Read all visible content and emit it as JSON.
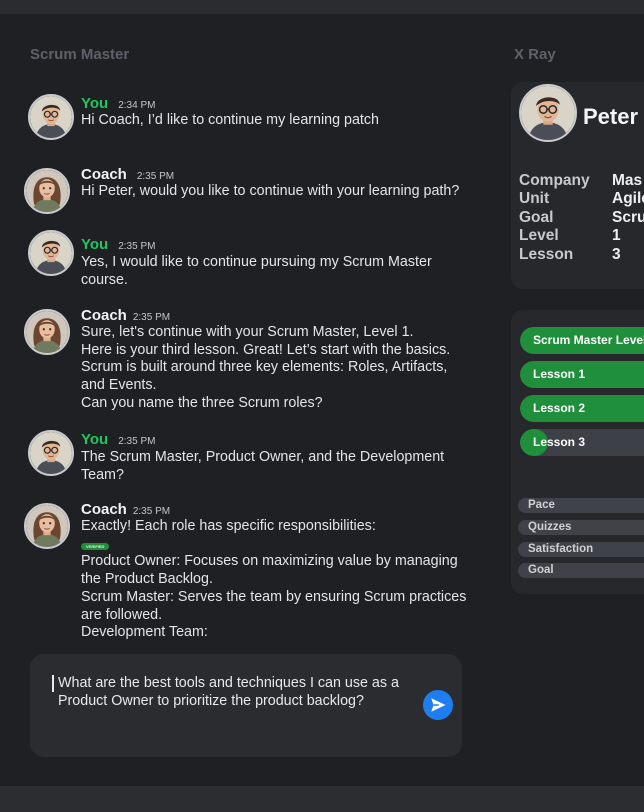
{
  "left_panel": {
    "title": "Scrum Master"
  },
  "right_panel": {
    "title": "X Ray"
  },
  "messages": [
    {
      "sender": "You",
      "time": "2:34 PM",
      "text": "Hi Coach, I’d like to continue my learning patch"
    },
    {
      "sender": "Coach",
      "time": "2:35 PM",
      "text": "Hi Peter, would you like to continue with your learning path?"
    },
    {
      "sender": "You",
      "time": "2:35 PM",
      "text": "Yes, I would like to continue pursuing my Scrum Master course."
    },
    {
      "sender": "Coach",
      "time": "2:35 PM",
      "lines": [
        "Sure, let's continue with your Scrum Master, Level 1.",
        "Here is your third lesson. Great! Let’s start with the basics. Scrum is built around three key elements: Roles, Artifacts, and Events.",
        "Can you name the three Scrum roles?"
      ]
    },
    {
      "sender": "You",
      "time": "2:35 PM",
      "text": "The Scrum Master, Product Owner, and the Development Team?"
    },
    {
      "sender": "Coach",
      "time": "2:35 PM",
      "intro": "Exactly! Each role has specific responsibilities:",
      "badge": "VERIFIED",
      "lines": [
        "Product Owner: Focuses on maximizing value by managing the Product Backlog.",
        "Scrum Master: Serves the team by ensuring Scrum practices are followed.",
        "Development Team:"
      ]
    }
  ],
  "input": {
    "value": "What are the best tools and techniques I can use as a Product Owner to prioritize the product backlog?"
  },
  "profile": {
    "name": "Peter",
    "fields": [
      {
        "key": "Company",
        "value": "Mas"
      },
      {
        "key": "Unit",
        "value": "Agile"
      },
      {
        "key": "Goal",
        "value": "Scru"
      },
      {
        "key": "Level",
        "value": "1"
      },
      {
        "key": "Lesson",
        "value": "3"
      }
    ]
  },
  "progress": [
    {
      "label": "Scrum Master Level",
      "fill_fraction": 1.0
    },
    {
      "label": "Lesson 1",
      "fill_fraction": 1.0
    },
    {
      "label": "Lesson 2",
      "fill_fraction": 1.0
    },
    {
      "label": "Lesson 3",
      "fill_fraction": 0.2
    }
  ],
  "metrics": [
    {
      "label": "Pace"
    },
    {
      "label": "Quizzes"
    },
    {
      "label": "Satisfaction"
    },
    {
      "label": "Goal"
    }
  ],
  "colors": {
    "you_name": "#22c55e",
    "progress_fill": "#1f8f3c",
    "send_button": "#1e7ef0"
  }
}
